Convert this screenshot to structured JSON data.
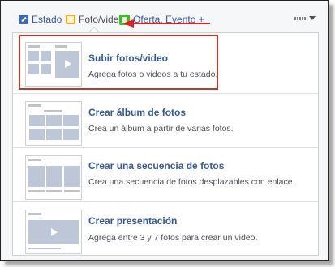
{
  "tabs": [
    {
      "label": "Estado",
      "icon": "pencil-icon"
    },
    {
      "label": "Foto/video",
      "icon": "photo-icon"
    },
    {
      "label": "Oferta, Evento +",
      "icon": "offer-icon"
    }
  ],
  "menu": {
    "options": [
      {
        "title": "Subir fotos/video",
        "description": "Agrega fotos o videos a tu estado.",
        "highlighted": true
      },
      {
        "title": "Crear álbum de fotos",
        "description": "Crea un álbum a partir de varias fotos."
      },
      {
        "title": "Crear una secuencia de fotos",
        "description": "Crea una secuencia de fotos desplazables con enlace."
      },
      {
        "title": "Crear presentación",
        "description": "Agrega entre 3 y 7 fotos para crear un video."
      }
    ]
  },
  "colors": {
    "link": "#365899",
    "annotation": "#e02020",
    "highlight": "#c0392b"
  }
}
